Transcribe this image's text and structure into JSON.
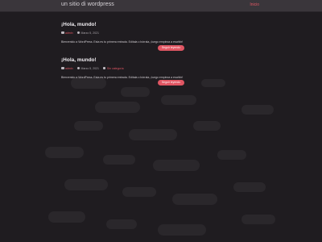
{
  "header": {
    "site_title": "un sitio di wordpress",
    "top_link": "Inicio"
  },
  "posts": [
    {
      "title": "¡Hola, mundo!",
      "author": "admin",
      "date": "Marzo 5, 2021",
      "category": "",
      "excerpt": "Bienvenido a WordPress. Esta es tu primera entrada. Edítala o bórrala, ¡luego empieza a escribir!",
      "button": "Seguir leyendo"
    },
    {
      "title": "¡Hola, mundo!",
      "author": "admin",
      "date": "Marzo 5, 2021",
      "category": "Sin categoría",
      "excerpt": "Bienvenido a WordPress. Esta es tu primera entrada. Edítala o bórrala, ¡luego empieza a escribir!",
      "button": "Seguir leyendo"
    }
  ],
  "colors": {
    "accent": "#e05663",
    "background": "#1f1c20",
    "topbar": "#3a363b"
  }
}
